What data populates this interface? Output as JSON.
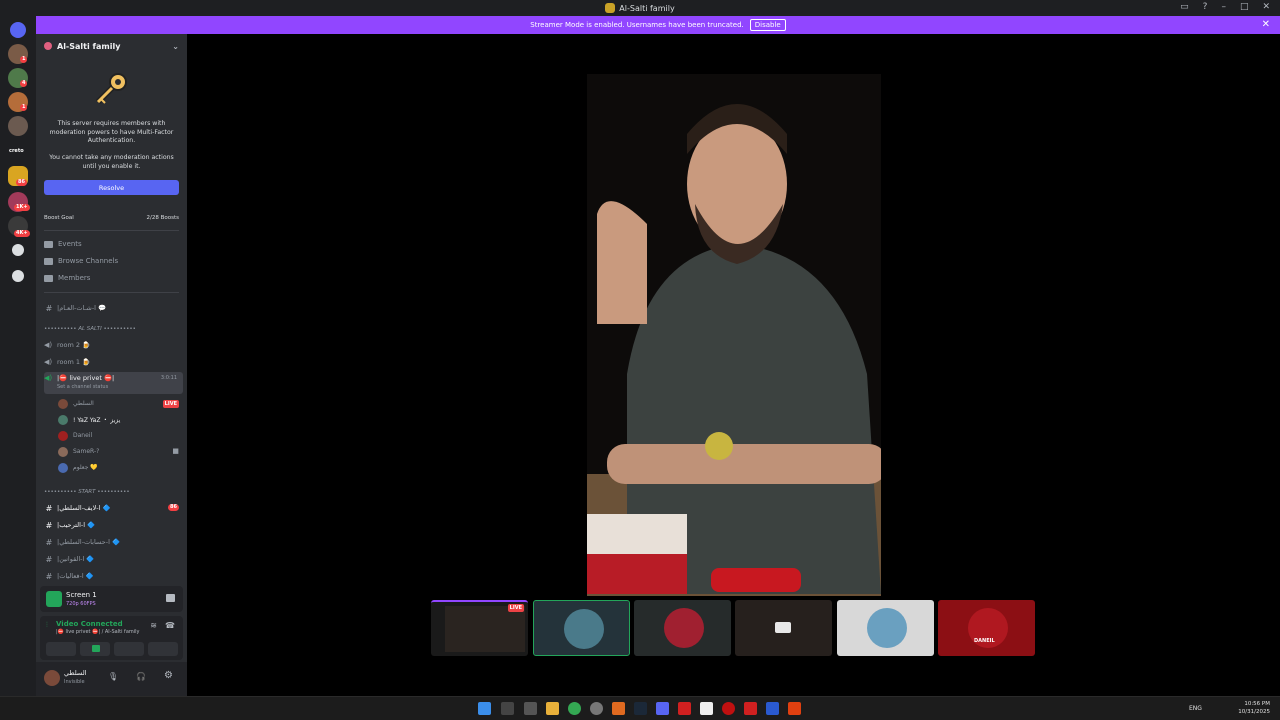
{
  "window": {
    "title": "Al-Salti family"
  },
  "banner": {
    "text": "Streamer Mode is enabled. Usernames have been truncated.",
    "disable_label": "Disable"
  },
  "server": {
    "name": "Al-Salti family",
    "mfa_line1": "This server requires members with moderation powers to have Multi-Factor Authentication.",
    "mfa_line2": "You cannot take any moderation actions until you enable it.",
    "resolve_label": "Resolve",
    "boost_label": "Boost Goal",
    "boost_count": "2/28 Boosts"
  },
  "nav": {
    "events": "Events",
    "browse": "Browse Channels",
    "members": "Members"
  },
  "channels": {
    "chat": "|ا-شـات-العـام 💬",
    "cat_alsalti": "•••••••••• AL SALTI ••••••••••",
    "room2": "room 2 🍺",
    "room1": "room 1 🍺",
    "live_privet": "|⛔ live privet ⛔|",
    "live_timer": "3:0:11",
    "live_status": "Set a channel status",
    "voice_users": [
      "السلطي",
      "! YaZ YaZ ・ يزيز",
      "Daneil",
      "SameR-?",
      "جعلوم 💛"
    ],
    "live_badge": "LIVE",
    "cat_start": "•••••••••• START ••••••••••",
    "text1": "|ا-لايف-السلطي 🔷",
    "text1_badge": "86",
    "text2": "|ا-الترحيب 🔷",
    "text3": "|ا-حسابات-السلطي 🔷",
    "text4": "|ا-القوانين 🔷",
    "text5": "|ا-فعاليات 🔷"
  },
  "stream_panel": {
    "title": "Screen 1",
    "quality": "720p 60FPS"
  },
  "voice_panel": {
    "status": "Video Connected",
    "location": "|⛔ live privet ⛔| / Al-Salti family"
  },
  "user": {
    "name": "السلطي",
    "status": "Invisible"
  },
  "guild_badges": [
    "1",
    "4",
    "1",
    "86",
    "1K+",
    "4K+"
  ],
  "guild_label_creto": "creto",
  "thumb_live_badge": "LIVE",
  "thumb_name": "DANEIL",
  "clock": {
    "time": "10:56 PM",
    "date": "10/31/2025"
  },
  "tray_lang": "ENG",
  "colors": {
    "accent": "#9146ff",
    "brand": "#5865f2",
    "live": "#ed4245",
    "connected": "#23a55a"
  }
}
